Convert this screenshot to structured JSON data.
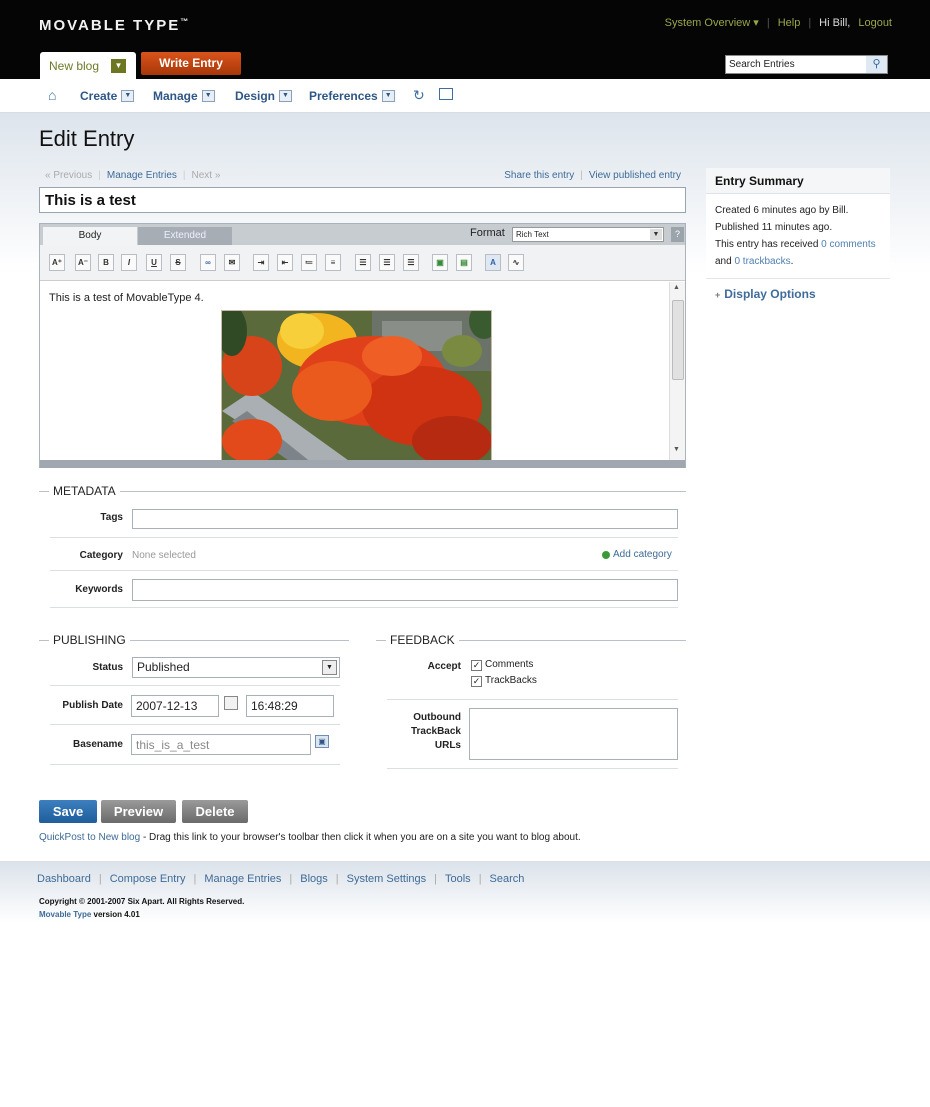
{
  "header": {
    "logo": "MOVABLE TYPE",
    "logo_tm": "™",
    "system_overview": "System Overview ▾",
    "help": "Help",
    "greeting": "Hi Bill,",
    "logout": "Logout",
    "blog_tab": "New blog",
    "write_entry": "Write Entry",
    "search_placeholder": "Search Entries"
  },
  "nav": {
    "create": "Create",
    "manage": "Manage",
    "design": "Design",
    "preferences": "Preferences"
  },
  "page": {
    "title": "Edit Entry",
    "previous": "« Previous",
    "manage_entries": "Manage Entries",
    "next": "Next »",
    "share_entry": "Share this entry",
    "view_published": "View published entry",
    "entry_title": "This is a test"
  },
  "editor": {
    "tab_body": "Body",
    "tab_extended": "Extended",
    "format_label": "Format",
    "format_value": "Rich Text",
    "help": "?",
    "body_text": "This is a test of MovableType 4."
  },
  "metadata": {
    "legend": "METADATA",
    "tags_label": "Tags",
    "tags_value": "",
    "category_label": "Category",
    "category_value": "None selected",
    "add_category": "Add category",
    "keywords_label": "Keywords",
    "keywords_value": ""
  },
  "publishing": {
    "legend": "PUBLISHING",
    "status_label": "Status",
    "status_value": "Published",
    "publish_date_label": "Publish Date",
    "date_value": "2007-12-13",
    "time_value": "16:48:29",
    "basename_label": "Basename",
    "basename_value": "this_is_a_test"
  },
  "feedback": {
    "legend": "FEEDBACK",
    "accept_label": "Accept",
    "comments": "Comments",
    "trackbacks": "TrackBacks",
    "outbound_label_1": "Outbound",
    "outbound_label_2": "TrackBack",
    "outbound_label_3": "URLs"
  },
  "summary": {
    "title": "Entry Summary",
    "created": "Created 6 minutes ago by Bill.",
    "published": "Published 11 minutes ago.",
    "received": "This entry has received",
    "comments_link": "0 comments",
    "and": "and",
    "trackbacks_link": "0 trackbacks",
    "period": ".",
    "display_options": "Display Options"
  },
  "actions": {
    "save": "Save",
    "preview": "Preview",
    "delete": "Delete",
    "quickpost_link": "QuickPost to New blog",
    "quickpost_text": " - Drag this link to your browser's toolbar then click it when you are on a site you want to blog about."
  },
  "footer": {
    "links": [
      "Dashboard",
      "Compose Entry",
      "Manage Entries",
      "Blogs",
      "System Settings",
      "Tools",
      "Search"
    ],
    "copyright": "Copyright © 2001-2007 Six Apart. All Rights Reserved.",
    "product": "Movable Type",
    "version": " version 4.01"
  },
  "colors": {
    "header_bg": "#050505",
    "accent_olive": "#6d7620",
    "write_entry_orange": "#c4480f",
    "link_blue": "#3e6b97",
    "save_blue": "#2b6cab"
  },
  "icons": [
    "home-icon",
    "refresh-icon",
    "view-site-icon",
    "search-icon",
    "calendar-icon",
    "unlock-icon",
    "add-icon"
  ]
}
